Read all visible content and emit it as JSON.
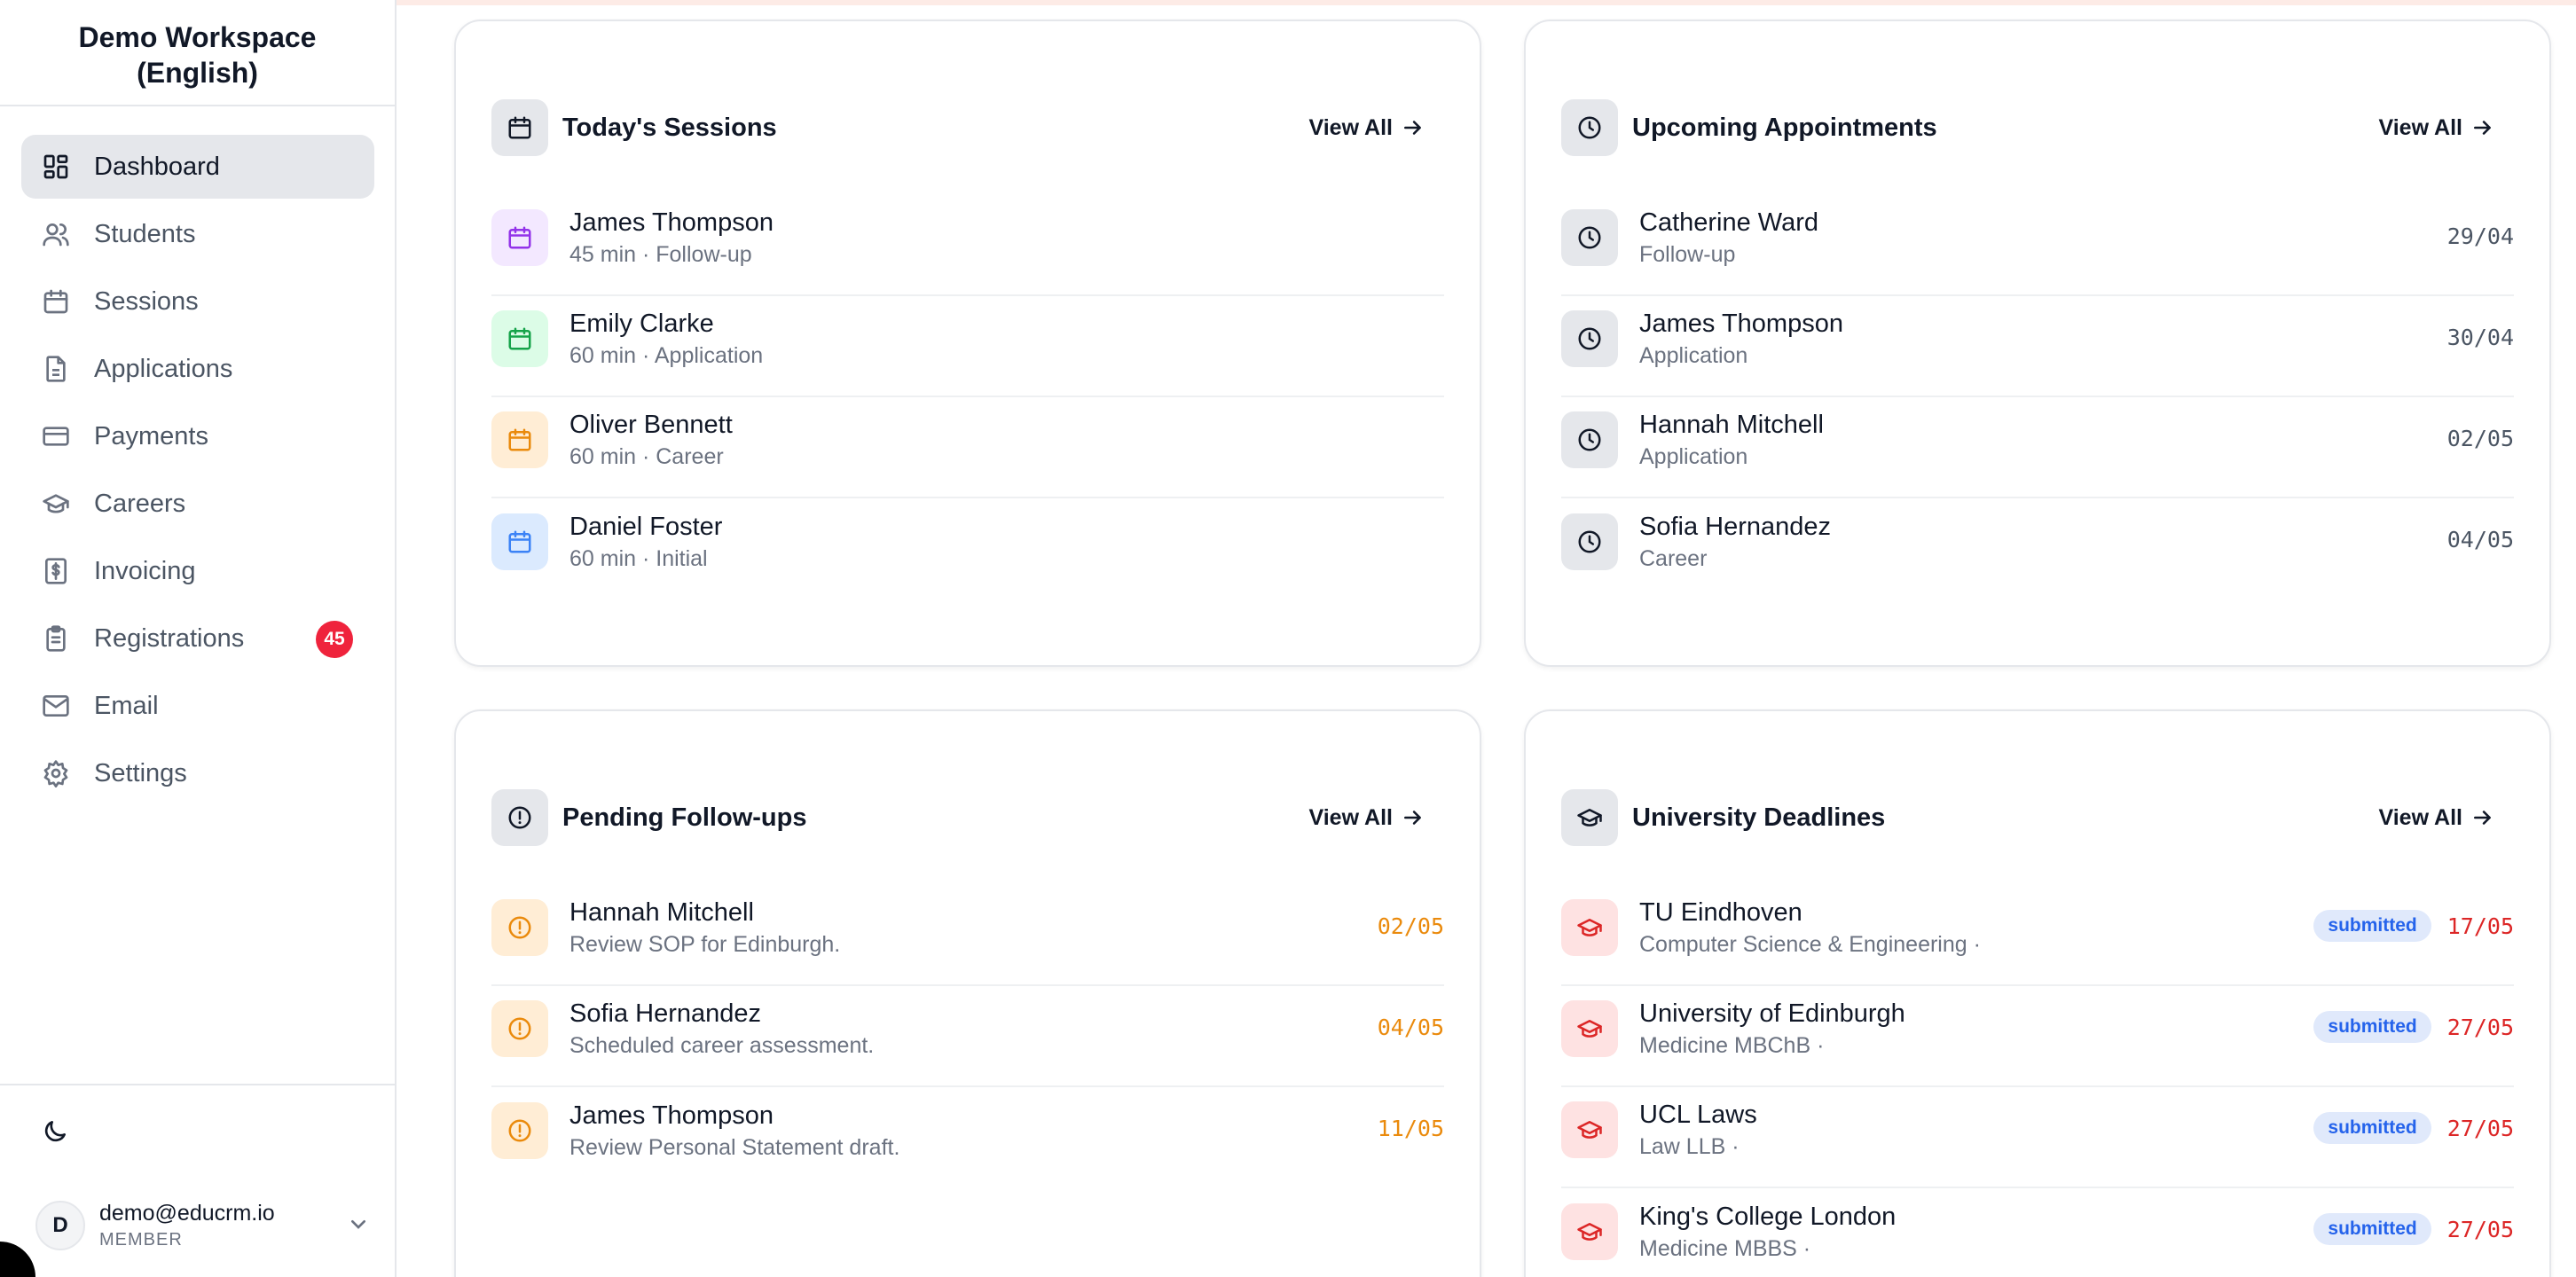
{
  "workspace": {
    "line1": "Demo Workspace",
    "line2": "(English)"
  },
  "nav": [
    {
      "label": "Dashboard",
      "icon": "dashboard-icon",
      "active": true
    },
    {
      "label": "Students",
      "icon": "users-icon"
    },
    {
      "label": "Sessions",
      "icon": "calendar-icon"
    },
    {
      "label": "Applications",
      "icon": "document-icon"
    },
    {
      "label": "Payments",
      "icon": "credit-card-icon"
    },
    {
      "label": "Careers",
      "icon": "graduation-cap-icon"
    },
    {
      "label": "Invoicing",
      "icon": "invoice-icon"
    },
    {
      "label": "Registrations",
      "icon": "clipboard-icon",
      "badge": "45"
    },
    {
      "label": "Email",
      "icon": "mail-icon"
    },
    {
      "label": "Settings",
      "icon": "gear-icon"
    }
  ],
  "user": {
    "initial": "D",
    "email": "demo@educrm.io",
    "role": "MEMBER"
  },
  "colors": {
    "active_nav_bg": "#e5e7eb",
    "badge": "#ef233c",
    "deadline_red": "#dc2626",
    "followup_orange": "#ea8a0c",
    "status_blue": "#2563eb"
  },
  "todays_sessions": {
    "title": "Today's Sessions",
    "view_all": "View All",
    "items": [
      {
        "name": "James Thompson",
        "sub": "45 min · Follow-up"
      },
      {
        "name": "Emily Clarke",
        "sub": "60 min · Application"
      },
      {
        "name": "Oliver Bennett",
        "sub": "60 min · Career"
      },
      {
        "name": "Daniel Foster",
        "sub": "60 min · Initial"
      }
    ]
  },
  "upcoming": {
    "title": "Upcoming Appointments",
    "view_all": "View All",
    "items": [
      {
        "name": "Catherine Ward",
        "sub": "Follow-up",
        "date": "29/04"
      },
      {
        "name": "James Thompson",
        "sub": "Application",
        "date": "30/04"
      },
      {
        "name": "Hannah Mitchell",
        "sub": "Application",
        "date": "02/05"
      },
      {
        "name": "Sofia Hernandez",
        "sub": "Career",
        "date": "04/05"
      }
    ]
  },
  "followups": {
    "title": "Pending Follow-ups",
    "view_all": "View All",
    "items": [
      {
        "name": "Hannah Mitchell",
        "sub": "Review SOP for Edinburgh.",
        "date": "02/05"
      },
      {
        "name": "Sofia Hernandez",
        "sub": "Scheduled career assessment.",
        "date": "04/05"
      },
      {
        "name": "James Thompson",
        "sub": "Review Personal Statement draft.",
        "date": "11/05"
      }
    ]
  },
  "deadlines": {
    "title": "University Deadlines",
    "view_all": "View All",
    "items": [
      {
        "name": "TU Eindhoven",
        "sub": "Computer Science & Engineering ·",
        "status": "submitted",
        "date": "17/05"
      },
      {
        "name": "University of Edinburgh",
        "sub": "Medicine MBChB ·",
        "status": "submitted",
        "date": "27/05"
      },
      {
        "name": "UCL Laws",
        "sub": "Law LLB ·",
        "status": "submitted",
        "date": "27/05"
      },
      {
        "name": "King's College London",
        "sub": "Medicine MBBS ·",
        "status": "submitted",
        "date": "27/05"
      }
    ]
  }
}
